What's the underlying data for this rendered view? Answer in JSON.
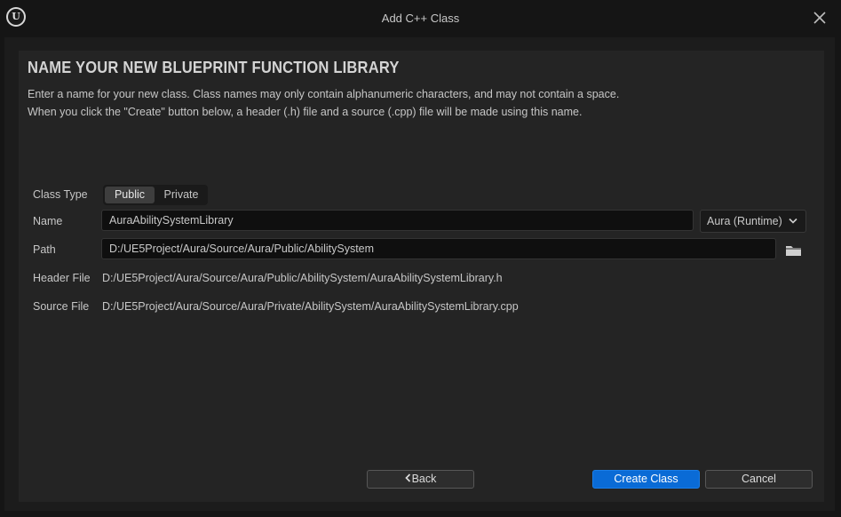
{
  "window": {
    "title": "Add C++ Class",
    "logo_icon": "unreal-engine-logo-icon",
    "logo_glyph": "U",
    "close_icon": "close-icon"
  },
  "header": {
    "title": "NAME YOUR NEW BLUEPRINT FUNCTION LIBRARY",
    "description_line1": "Enter a name for your new class. Class names may only contain alphanumeric characters, and may not contain a space.",
    "description_line2": "When you click the \"Create\" button below, a header (.h) file and a source (.cpp) file will be made using this name."
  },
  "form": {
    "class_type": {
      "label": "Class Type",
      "options": [
        "Public",
        "Private"
      ],
      "selected": "Public"
    },
    "name": {
      "label": "Name",
      "value": "AuraAbilitySystemLibrary"
    },
    "module": {
      "selected": "Aura (Runtime)",
      "icon": "chevron-down-icon"
    },
    "path": {
      "label": "Path",
      "value": "D:/UE5Project/Aura/Source/Aura/Public/AbilitySystem",
      "browse_icon": "folder-icon"
    },
    "header_file": {
      "label": "Header File",
      "value": "D:/UE5Project/Aura/Source/Aura/Public/AbilitySystem/AuraAbilitySystemLibrary.h"
    },
    "source_file": {
      "label": "Source File",
      "value": "D:/UE5Project/Aura/Source/Aura/Private/AbilitySystem/AuraAbilitySystemLibrary.cpp"
    }
  },
  "footer": {
    "back_label": "Back",
    "create_label": "Create Class",
    "cancel_label": "Cancel"
  },
  "colors": {
    "accent": "#0a6bd6",
    "panel": "#242424",
    "background": "#151515"
  }
}
